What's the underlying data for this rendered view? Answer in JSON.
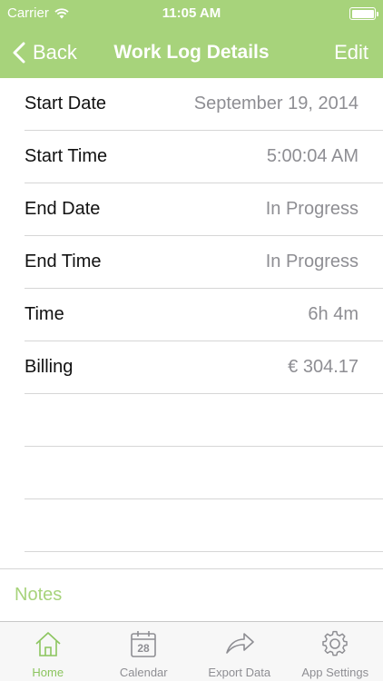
{
  "status_bar": {
    "carrier": "Carrier",
    "time": "11:05 AM"
  },
  "nav": {
    "back_label": "Back",
    "title": "Work Log Details",
    "edit_label": "Edit"
  },
  "details": [
    {
      "label": "Start Date",
      "value": "September 19, 2014"
    },
    {
      "label": "Start Time",
      "value": "5:00:04 AM"
    },
    {
      "label": "End Date",
      "value": "In Progress"
    },
    {
      "label": "End Time",
      "value": "In Progress"
    },
    {
      "label": "Time",
      "value": "6h 4m"
    },
    {
      "label": "Billing",
      "value": "€ 304.17"
    }
  ],
  "notes": {
    "label": "Notes"
  },
  "tabs": [
    {
      "label": "Home",
      "icon": "home-icon",
      "active": true
    },
    {
      "label": "Calendar",
      "icon": "calendar-icon",
      "day": "28"
    },
    {
      "label": "Export Data",
      "icon": "share-arrow-icon"
    },
    {
      "label": "App Settings",
      "icon": "gear-icon"
    }
  ],
  "colors": {
    "accent": "#a7d37b",
    "active_tab": "#8cc55f",
    "inactive_tab": "#8e8e93",
    "value_text": "#8e8e93"
  }
}
